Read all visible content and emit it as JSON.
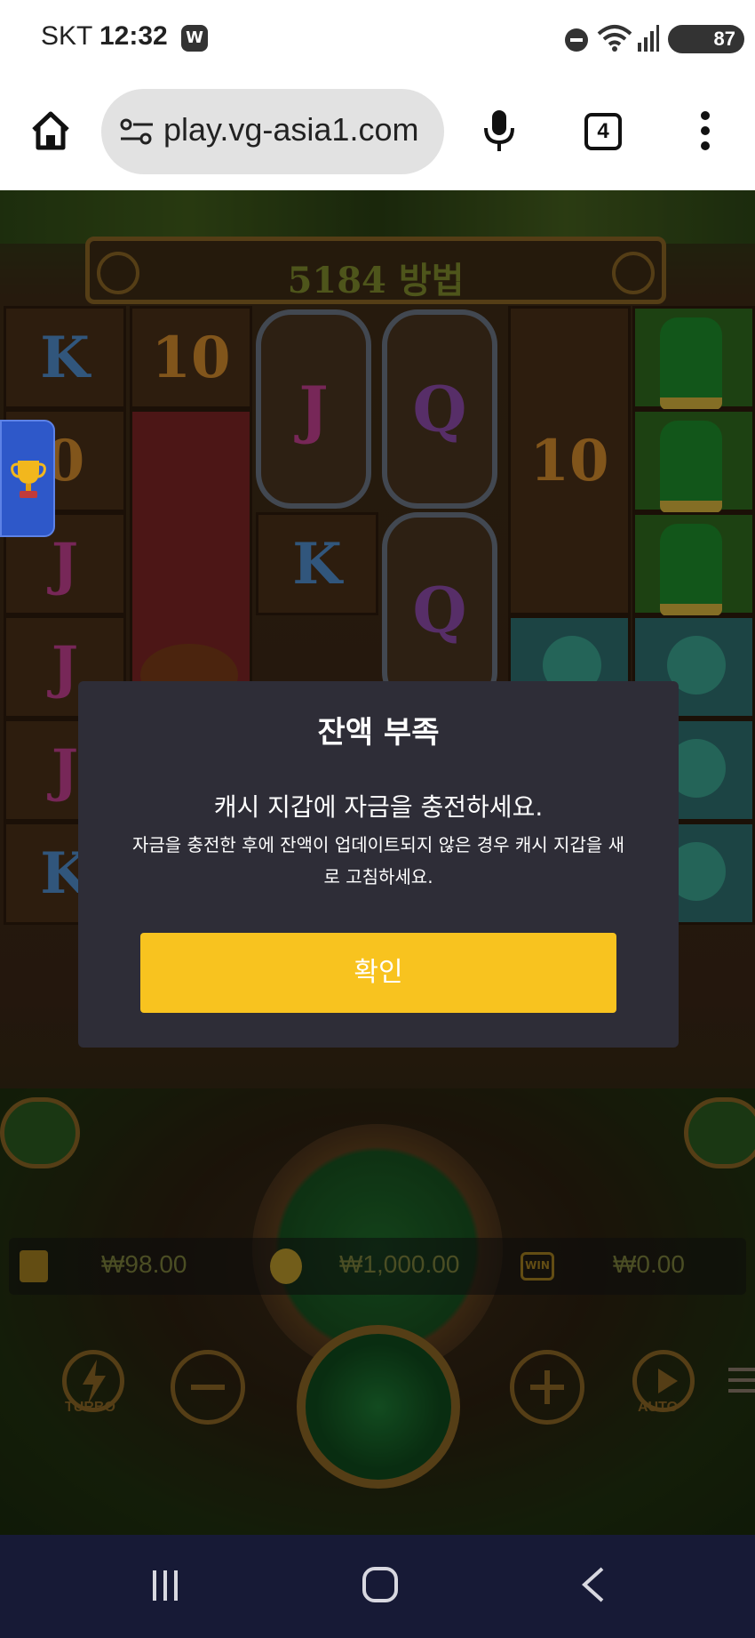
{
  "status_bar": {
    "carrier": "SKT",
    "time": "12:32",
    "app_badge": "W",
    "battery": "87"
  },
  "browser": {
    "url": "play.vg-asia1.com",
    "tab_count": "4"
  },
  "game": {
    "ways_banner": "5184 방법",
    "reel_symbols": [
      [
        "K",
        "0",
        "J",
        "J",
        "J",
        "K"
      ],
      [
        "10"
      ],
      [
        "J",
        "K"
      ],
      [
        "Q",
        "Q"
      ],
      [
        "10"
      ]
    ],
    "info_bar": {
      "balance": "₩98.00",
      "bet": "₩1,000.00",
      "win": "₩0.00",
      "win_icon_text": "WIN"
    },
    "controls": {
      "turbo_label": "TURBO",
      "auto_label": "AUTO"
    }
  },
  "dialog": {
    "title": "잔액 부족",
    "message": "캐시 지갑에 자금을 충전하세요.",
    "submessage": "자금을 충전한 후에 잔액이 업데이트되지 않은 경우 캐시 지갑을 새로 고침하세요.",
    "confirm_label": "확인"
  },
  "colors": {
    "dialog_bg": "#2e2d37",
    "confirm_button": "#f8c31f",
    "nav_bar": "#171a36"
  }
}
